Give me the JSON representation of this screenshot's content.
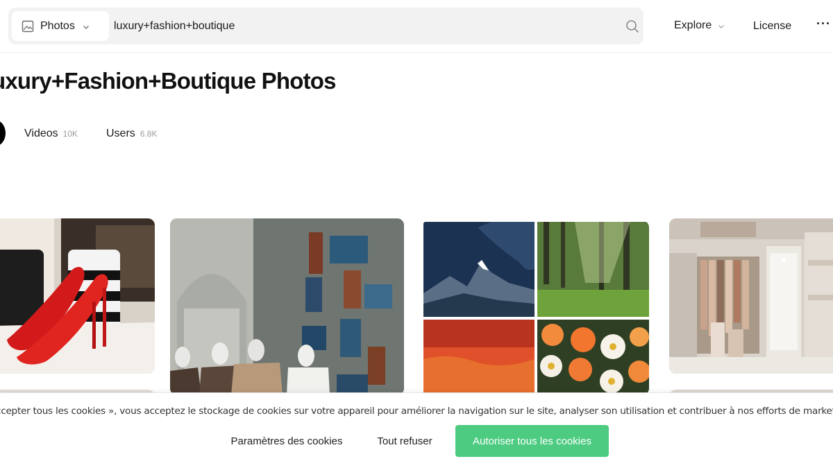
{
  "header": {
    "search_type_label": "Photos",
    "search_query": "luxury+fashion+boutique",
    "nav_explore": "Explore",
    "nav_license": "License",
    "nav_more": "···"
  },
  "page": {
    "title": "uxury+Fashion+Boutique Photos"
  },
  "tabs": [
    {
      "label": "Videos",
      "count": "10K"
    },
    {
      "label": "Users",
      "count": "6.8K"
    }
  ],
  "gallery": [
    {
      "subject": "red high heels"
    },
    {
      "subject": "boutique window mannequins"
    },
    {
      "subject": "nature collage"
    },
    {
      "subject": "clothing store interior"
    }
  ],
  "cookie_banner": {
    "text": "ccepter tous les cookies », vous acceptez le stockage de cookies sur votre appareil pour améliorer la navigation sur le site, analyser son utilisation et contribuer à nos efforts de marketing.",
    "settings_label": "Paramètres des cookies",
    "refuse_label": "Tout refuser",
    "accept_label": "Autoriser tous les cookies",
    "accept_color": "#4ccb81"
  },
  "icons": [
    "image-icon",
    "chevron-down-icon",
    "search-icon",
    "more-icon"
  ]
}
